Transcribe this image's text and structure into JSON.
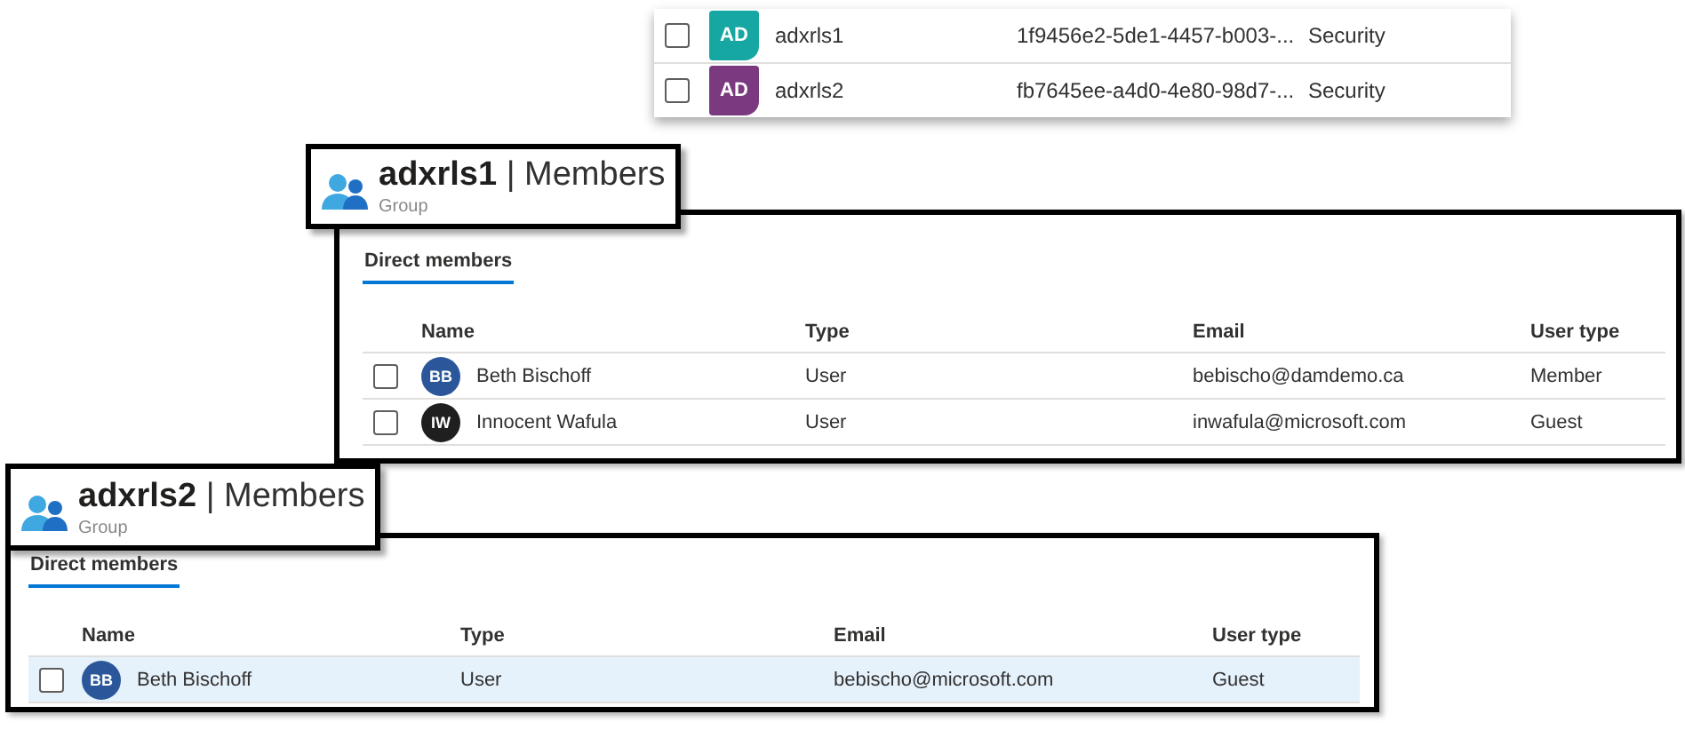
{
  "group_list": {
    "rows": [
      {
        "checked": false,
        "initials": "AD",
        "color": "#16a7a3",
        "name": "adxrls1",
        "object_id": "1f9456e2-5de1-4457-b003-...",
        "type": "Security"
      },
      {
        "checked": false,
        "initials": "AD",
        "color": "#7b3a80",
        "name": "adxrls2",
        "object_id": "fb7645ee-a4d0-4e80-98d7-...",
        "type": "Security"
      }
    ]
  },
  "member_panels": [
    {
      "title": "**adxrls1** | Members",
      "subtitle": "Group",
      "tabs": [
        {
          "label": "Direct members",
          "selected": true
        }
      ],
      "columns": [
        "Name",
        "Type",
        "Email",
        "User type"
      ],
      "rows": [
        {
          "checked": false,
          "selected": false,
          "initials": "BB",
          "color": "#2b579a",
          "name": "Beth Bischoff",
          "type": "User",
          "email": "bebischo@damdemo.ca",
          "user_type": "Member"
        },
        {
          "checked": false,
          "selected": false,
          "initials": "IW",
          "color": "#1f1f1f",
          "name": "Innocent Wafula",
          "type": "User",
          "email": "inwafula@microsoft.com",
          "user_type": "Guest"
        }
      ]
    },
    {
      "title": "**adxrls2** | Members",
      "subtitle": "Group",
      "tabs": [
        {
          "label": "Direct members",
          "selected": true
        }
      ],
      "columns": [
        "Name",
        "Type",
        "Email",
        "User type"
      ],
      "rows": [
        {
          "checked": false,
          "selected": true,
          "initials": "BB",
          "color": "#2b579a",
          "name": "Beth Bischoff",
          "type": "User",
          "email": "bebischo@microsoft.com",
          "user_type": "Guest"
        }
      ]
    }
  ]
}
